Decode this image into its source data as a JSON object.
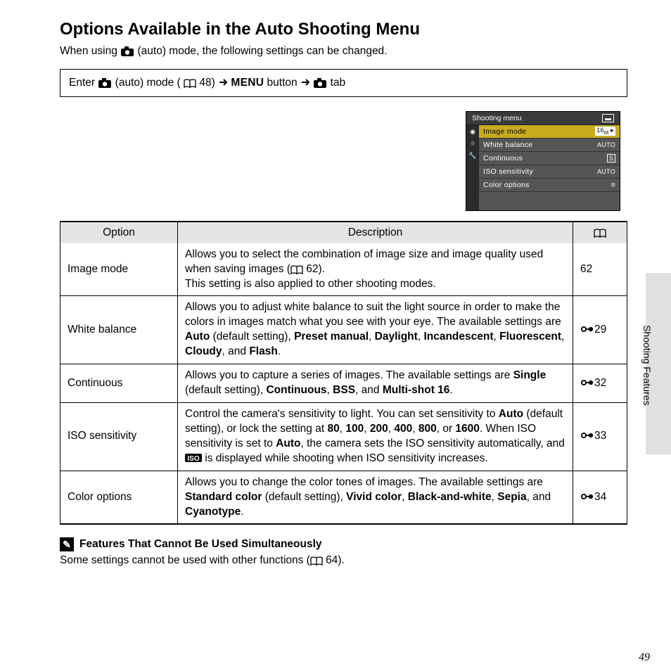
{
  "title": "Options Available in the Auto Shooting Menu",
  "intro_1": "When using ",
  "intro_2": " (auto) mode, the following settings can be changed.",
  "nav_1": "Enter ",
  "nav_2": " (auto) mode (",
  "nav_3": " 48) ",
  "nav_menu": "MENU",
  "nav_4": " button ",
  "nav_5": " tab",
  "lcd": {
    "title": "Shooting menu",
    "rows": [
      {
        "label": "Image mode",
        "value": "",
        "sel": true
      },
      {
        "label": "White balance",
        "value": "AUTO"
      },
      {
        "label": "Continuous",
        "value": "S"
      },
      {
        "label": "ISO sensitivity",
        "value": "AUTO"
      },
      {
        "label": "Color options",
        "value": ""
      }
    ]
  },
  "table": {
    "headers": {
      "opt": "Option",
      "desc": "Description"
    },
    "rows": [
      {
        "opt": "Image mode",
        "desc_a": "Allows you to select the combination of image size and image quality used when saving images (",
        "desc_b": " 62).",
        "desc_c": "This setting is also applied to other shooting modes.",
        "ref": "62",
        "reficon": ""
      },
      {
        "opt": "White balance",
        "desc_a": "Allows you to adjust white balance to suit the light source in order to make the colors in images match what you see with your eye. The available settings are ",
        "b1": "Auto",
        "t1": " (default setting), ",
        "b2": "Preset manual",
        "t2": ", ",
        "b3": "Daylight",
        "t3": ", ",
        "b4": "Incandescent",
        "t4": ", ",
        "b5": "Fluorescent",
        "t5": ", ",
        "b6": "Cloudy",
        "t6": ", and ",
        "b7": "Flash",
        "t7": ".",
        "ref": "29",
        "reficon": "ext"
      },
      {
        "opt": "Continuous",
        "desc_a": "Allows you to capture a series of images. The available settings are ",
        "b1": "Single",
        "t1": " (default setting), ",
        "b2": "Continuous",
        "t2": ", ",
        "b3": "BSS",
        "t3": ", and ",
        "b4": "Multi-shot 16",
        "t4": ".",
        "ref": "32",
        "reficon": "ext"
      },
      {
        "opt": "ISO sensitivity",
        "desc_a": "Control the camera's sensitivity to light. You can set sensitivity to ",
        "b1": "Auto",
        "t1": " (default setting), or lock the setting at ",
        "b2": "80",
        "t2": ", ",
        "b3": "100",
        "t3": ", ",
        "b4": "200",
        "t4": ", ",
        "b5": "400",
        "t5": ", ",
        "b6": "800",
        "t6": ", or ",
        "b7": "1600",
        "t7": ". When ISO sensitivity is set to ",
        "b8": "Auto",
        "t8": ", the camera sets the ISO sensitivity automatically, and ",
        "t9": " is displayed while shooting when ISO sensitivity increases.",
        "ref": "33",
        "reficon": "ext"
      },
      {
        "opt": "Color options",
        "desc_a": "Allows you to change the color tones of images. The available settings are ",
        "b1": "Standard color",
        "t1": " (default setting), ",
        "b2": "Vivid color",
        "t2": ", ",
        "b3": "Black-and-white",
        "t3": ", ",
        "b4": "Sepia",
        "t4": ", and ",
        "b5": "Cyanotype",
        "t5": ".",
        "ref": "34",
        "reficon": "ext"
      }
    ]
  },
  "note_head": "Features That Cannot Be Used Simultaneously",
  "note_body_a": "Some settings cannot be used with other functions (",
  "note_body_b": " 64).",
  "sidebar": "Shooting Features",
  "pagenum": "49"
}
